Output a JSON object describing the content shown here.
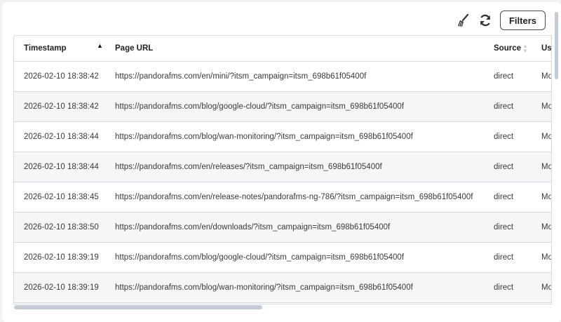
{
  "toolbar": {
    "clear_icon": "broom-icon",
    "refresh_icon": "refresh-icon",
    "filters_label": "Filters"
  },
  "table": {
    "columns": [
      {
        "label": "Timestamp",
        "sort": "ascending"
      },
      {
        "label": "Page URL",
        "sort": "none"
      },
      {
        "label": "Source",
        "sort": "none"
      },
      {
        "label": "Us",
        "sort": "none"
      }
    ],
    "rows": [
      {
        "timestamp": "2026-02-10 18:38:42",
        "url": "https://pandorafms.com/en/mini/?itsm_campaign=itsm_698b61f05400f",
        "source": "direct",
        "user": "Mo"
      },
      {
        "timestamp": "2026-02-10 18:38:42",
        "url": "https://pandorafms.com/blog/google-cloud/?itsm_campaign=itsm_698b61f05400f",
        "source": "direct",
        "user": "Mo"
      },
      {
        "timestamp": "2026-02-10 18:38:44",
        "url": "https://pandorafms.com/blog/wan-monitoring/?itsm_campaign=itsm_698b61f05400f",
        "source": "direct",
        "user": "Mo"
      },
      {
        "timestamp": "2026-02-10 18:38:44",
        "url": "https://pandorafms.com/en/releases/?itsm_campaign=itsm_698b61f05400f",
        "source": "direct",
        "user": "Mo"
      },
      {
        "timestamp": "2026-02-10 18:38:45",
        "url": "https://pandorafms.com/en/release-notes/pandorafms-ng-786/?itsm_campaign=itsm_698b61f05400f",
        "source": "direct",
        "user": "Mo"
      },
      {
        "timestamp": "2026-02-10 18:38:50",
        "url": "https://pandorafms.com/en/downloads/?itsm_campaign=itsm_698b61f05400f",
        "source": "direct",
        "user": "Mo"
      },
      {
        "timestamp": "2026-02-10 18:39:19",
        "url": "https://pandorafms.com/blog/google-cloud/?itsm_campaign=itsm_698b61f05400f",
        "source": "direct",
        "user": "Mo"
      },
      {
        "timestamp": "2026-02-10 18:39:19",
        "url": "https://pandorafms.com/blog/wan-monitoring/?itsm_campaign=itsm_698b61f05400f",
        "source": "direct",
        "user": "Mo"
      }
    ]
  }
}
